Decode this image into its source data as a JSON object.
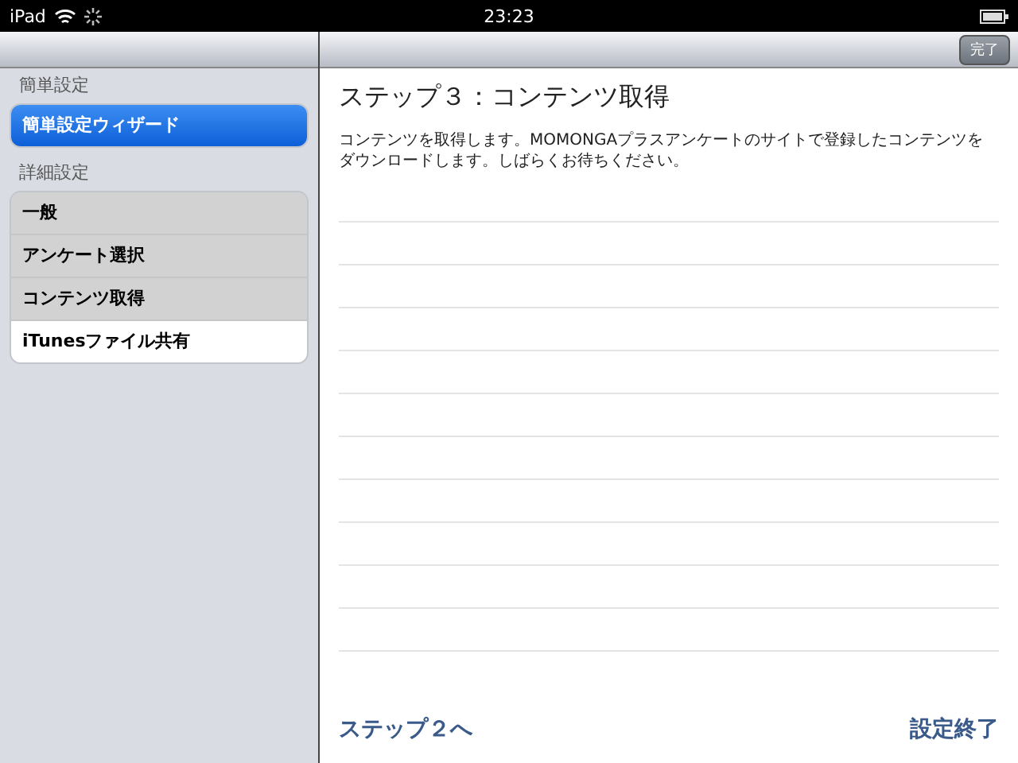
{
  "status_bar": {
    "device": "iPad",
    "time": "23:23"
  },
  "nav": {
    "done_button": "完了"
  },
  "sidebar": {
    "sections": [
      {
        "header": "簡単設定",
        "items": [
          {
            "label": "簡単設定ウィザード",
            "selected": true
          }
        ]
      },
      {
        "header": "詳細設定",
        "items": [
          {
            "label": "一般",
            "selected": false,
            "disabled": true
          },
          {
            "label": "アンケート選択",
            "selected": false,
            "disabled": true
          },
          {
            "label": "コンテンツ取得",
            "selected": false,
            "disabled": true
          },
          {
            "label": "iTunesファイル共有",
            "selected": false,
            "disabled": false
          }
        ]
      }
    ]
  },
  "content": {
    "title": "ステップ３：コンテンツ取得",
    "description": "コンテンツを取得します。MOMONGAプラスアンケートのサイトで登録したコンテンツをダウンロードします。しばらくお待ちください。",
    "back_link": "ステップ２へ",
    "finish_link": "設定終了"
  }
}
